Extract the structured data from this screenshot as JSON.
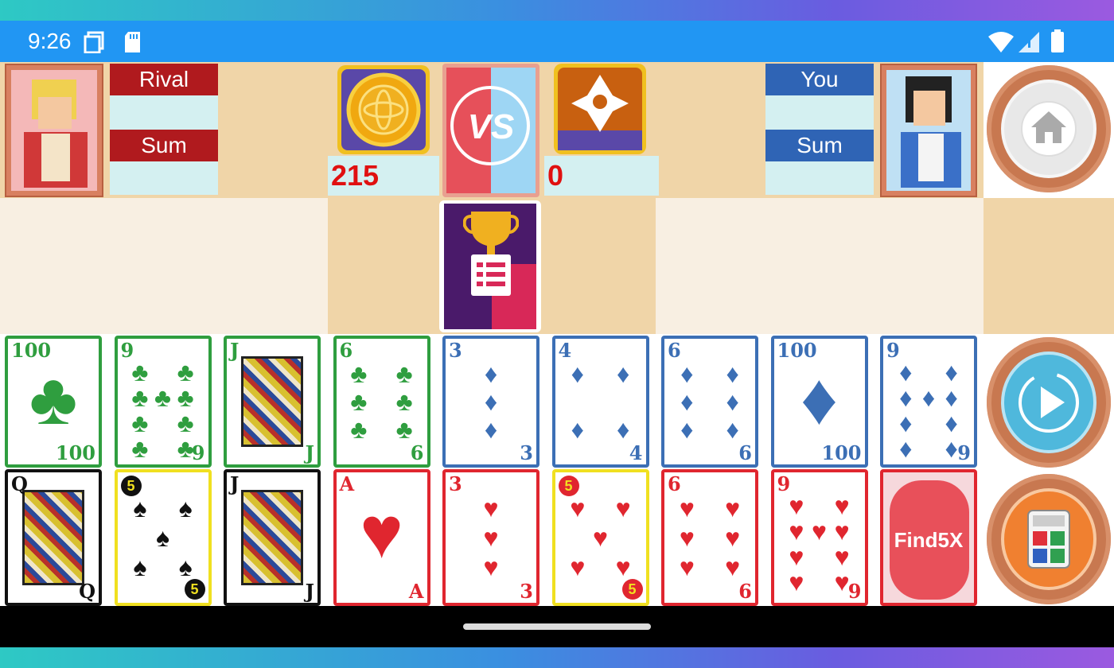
{
  "status_bar": {
    "time": "9:26"
  },
  "rival": {
    "label": "Rival",
    "sum_label": "Sum",
    "value": "",
    "sum": ""
  },
  "you": {
    "label": "You",
    "sum_label": "Sum",
    "value": "",
    "sum": ""
  },
  "coins": {
    "value": "215"
  },
  "gems": {
    "value": "0"
  },
  "vs_text": "VS",
  "find_card_text": "Find5X",
  "colors": {
    "status_bar": "#2196f3",
    "tan": "#f0d5a8",
    "cream": "#f8efe2",
    "rival_red": "#b01a1e",
    "you_blue": "#2f64b5",
    "score_red": "#e01010"
  },
  "cards": {
    "row1": [
      {
        "rank": "100",
        "suit": "♣",
        "color": "green"
      },
      {
        "rank": "9",
        "suit": "♣",
        "color": "green"
      },
      {
        "rank": "J",
        "suit": "♣",
        "color": "green"
      },
      {
        "rank": "6",
        "suit": "♣",
        "color": "green"
      },
      {
        "rank": "3",
        "suit": "♦",
        "color": "blue"
      },
      {
        "rank": "4",
        "suit": "♦",
        "color": "blue"
      },
      {
        "rank": "6",
        "suit": "♦",
        "color": "blue"
      },
      {
        "rank": "100",
        "suit": "♦",
        "color": "blue"
      },
      {
        "rank": "9",
        "suit": "♦",
        "color": "blue"
      }
    ],
    "row2": [
      {
        "rank": "Q",
        "suit": "♠",
        "color": "black"
      },
      {
        "rank": "5",
        "suit": "♠",
        "color": "yellow"
      },
      {
        "rank": "J",
        "suit": "♠",
        "color": "black"
      },
      {
        "rank": "A",
        "suit": "♥",
        "color": "red"
      },
      {
        "rank": "3",
        "suit": "♥",
        "color": "red"
      },
      {
        "rank": "5",
        "suit": "♥",
        "color": "yellow"
      },
      {
        "rank": "6",
        "suit": "♥",
        "color": "red"
      },
      {
        "rank": "9",
        "suit": "♥",
        "color": "red"
      }
    ]
  },
  "icons": {
    "home": "home-icon",
    "play": "play-icon",
    "calculator": "calculator-icon",
    "coin": "coin-icon",
    "gem": "gem-icon",
    "trophy": "trophy-icon"
  }
}
